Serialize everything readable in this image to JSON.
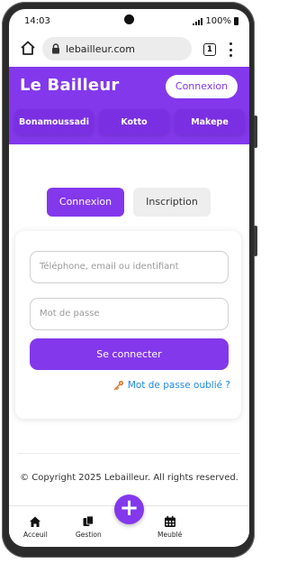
{
  "status_bar": {
    "time": "14:03",
    "battery": "100%"
  },
  "browser": {
    "url": "lebailleur.com",
    "tab_count": "1"
  },
  "header": {
    "brand": "Le Bailleur",
    "login_button": "Connexion",
    "neighborhoods": [
      "Bonamoussadi",
      "Kotto",
      "Makepe"
    ]
  },
  "auth_tabs": {
    "login": "Connexion",
    "register": "Inscription"
  },
  "form": {
    "identifier_placeholder": "Téléphone, email ou identifiant",
    "password_placeholder": "Mot de passe",
    "submit": "Se connecter",
    "forgot_password": "Mot de passe oublié ?"
  },
  "footer": {
    "copyright": "© Copyright 2025 Lebailleur. All rights reserved."
  },
  "bottom_nav": {
    "home": "Acceuil",
    "management": "Gestion",
    "furnished": "Meublé",
    "add_symbol": "+"
  },
  "colors": {
    "accent": "#8338ec",
    "link": "#1e88e5"
  },
  "icons": [
    "home-icon",
    "lock-icon",
    "tabs-icon",
    "more-icon",
    "key-icon",
    "copy-icon",
    "calendar-icon",
    "plus-icon"
  ]
}
